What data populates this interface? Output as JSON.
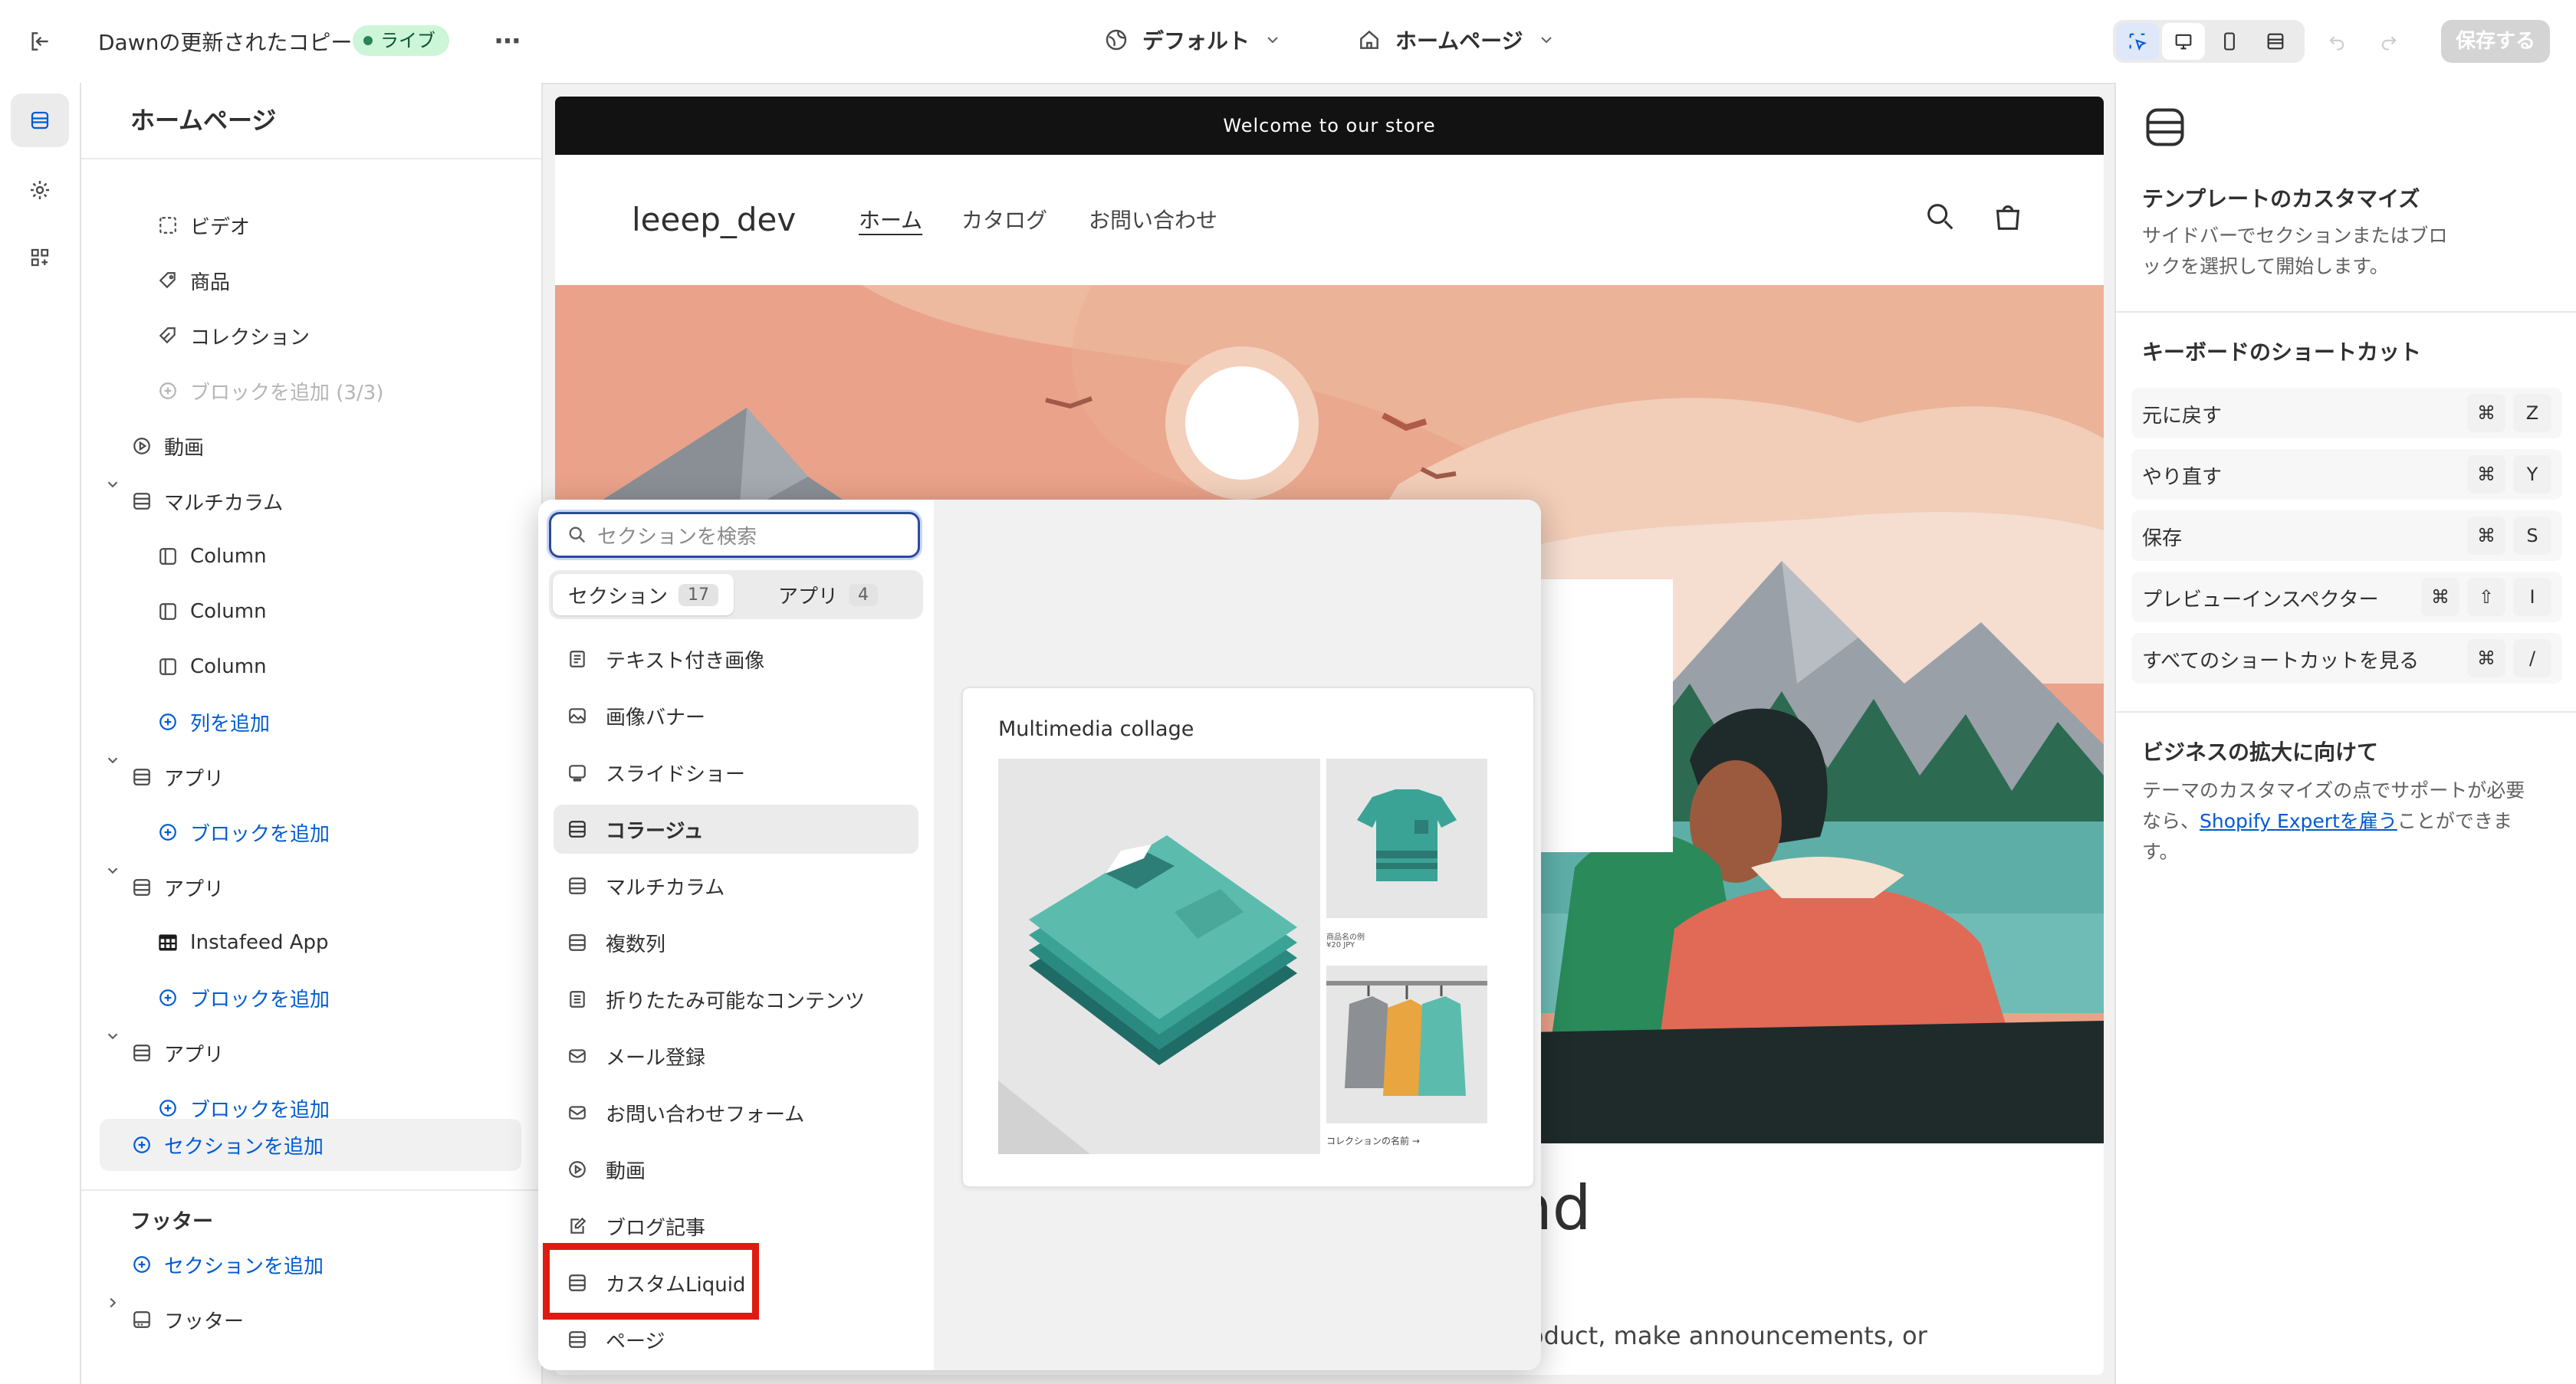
{
  "topbar": {
    "title": "Dawnの更新されたコピー",
    "live_badge": "ライブ",
    "theme_selector": "デフォルト",
    "page_selector": "ホームページ",
    "save_label": "保存する"
  },
  "sidebar": {
    "title": "ホームページ",
    "items": [
      {
        "label": "ビデオ",
        "icon": "video-frame-icon"
      },
      {
        "label": "商品",
        "icon": "tag-icon"
      },
      {
        "label": "コレクション",
        "icon": "collection-tag-icon"
      },
      {
        "label": "ブロックを追加 (3/3)",
        "icon": "add-circle-icon"
      },
      {
        "label": "動画",
        "icon": "play-circle-icon"
      },
      {
        "label": "マルチカラム",
        "icon": "section-icon"
      },
      {
        "label": "Column",
        "icon": "column-icon"
      },
      {
        "label": "Column",
        "icon": "column-icon"
      },
      {
        "label": "Column",
        "icon": "column-icon"
      },
      {
        "label": "列を追加",
        "icon": "add-circle-icon"
      },
      {
        "label": "アプリ",
        "icon": "section-icon"
      },
      {
        "label": "ブロックを追加",
        "icon": "add-circle-icon"
      },
      {
        "label": "アプリ",
        "icon": "section-icon"
      },
      {
        "label": "Instafeed App",
        "icon": "app-grid-icon"
      },
      {
        "label": "ブロックを追加",
        "icon": "add-circle-icon"
      },
      {
        "label": "アプリ",
        "icon": "section-icon"
      },
      {
        "label": "ブロックを追加",
        "icon": "add-circle-icon"
      },
      {
        "label": "セクションを追加",
        "icon": "add-circle-icon"
      }
    ],
    "footer_group": "フッター",
    "footer_add": "セクションを追加",
    "footer_item": "フッター"
  },
  "preview": {
    "announcement": "Welcome to our store",
    "logo": "leeep_dev",
    "nav": [
      "ホーム",
      "カタログ",
      "お問い合わせ"
    ],
    "heading_partial": "nd",
    "body_partial": "oduct, make announcements, or"
  },
  "section_picker": {
    "search_placeholder": "セクションを検索",
    "tabs": [
      {
        "label": "セクション",
        "count": "17"
      },
      {
        "label": "アプリ",
        "count": "4"
      }
    ],
    "items": [
      "テキスト付き画像",
      "画像バナー",
      "スライドショー",
      "コラージュ",
      "マルチカラム",
      "複数列",
      "折りたたみ可能なコンテンツ",
      "メール登録",
      "お問い合わせフォーム",
      "動画",
      "ブログ記事",
      "カスタムLiquid",
      "ページ"
    ],
    "selected_index": 3,
    "preview_card": {
      "title": "Multimedia collage",
      "product_name": "商品名の例",
      "product_price": "¥20 JPY",
      "collection_link": "コレクションの名前 →"
    }
  },
  "right_panel": {
    "customize_title": "テンプレートのカスタマイズ",
    "customize_desc": "サイドバーでセクションまたはブロックを選択して開始します。",
    "shortcuts_title": "キーボードのショートカット",
    "shortcuts": [
      {
        "label": "元に戻す",
        "keys": [
          "⌘",
          "Z"
        ]
      },
      {
        "label": "やり直す",
        "keys": [
          "⌘",
          "Y"
        ]
      },
      {
        "label": "保存",
        "keys": [
          "⌘",
          "S"
        ]
      },
      {
        "label": "プレビューインスペクター",
        "keys": [
          "⌘",
          "⇧",
          "I"
        ]
      },
      {
        "label": "すべてのショートカットを見る",
        "keys": [
          "⌘",
          "/"
        ]
      }
    ],
    "business_title": "ビジネスの拡大に向けて",
    "business_desc_1": "テーマのカスタマイズの点でサポートが必要なら、",
    "business_link": "Shopify Expertを雇う",
    "business_desc_2": "ことができます。"
  },
  "colors": {
    "accent_blue": "#005bd3",
    "live_green": "#cdf5d8",
    "highlight_red": "#e01a10"
  }
}
